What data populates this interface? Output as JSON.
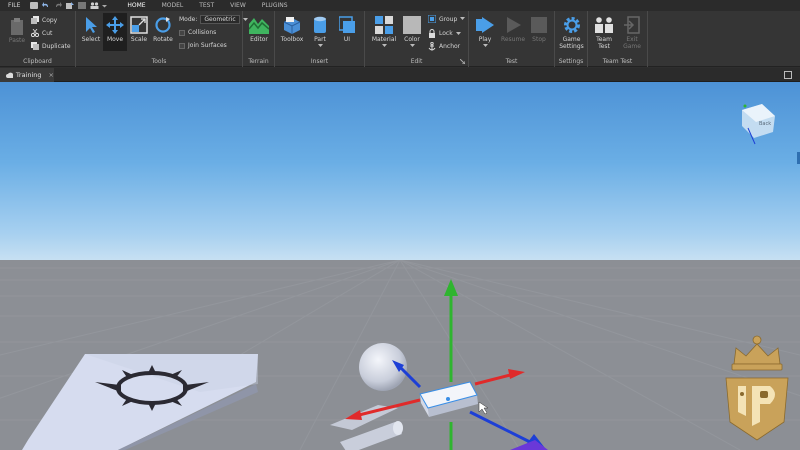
{
  "menu": {
    "file": "FILE",
    "tabs": [
      {
        "label": "HOME",
        "active": true
      },
      {
        "label": "MODEL",
        "active": false
      },
      {
        "label": "TEST",
        "active": false
      },
      {
        "label": "VIEW",
        "active": false
      },
      {
        "label": "PLUGINS",
        "active": false
      }
    ]
  },
  "ribbon": {
    "clipboard": {
      "paste": "Paste",
      "copy": "Copy",
      "cut": "Cut",
      "duplicate": "Duplicate",
      "label": "Clipboard"
    },
    "tools": {
      "select": "Select",
      "move": "Move",
      "scale": "Scale",
      "rotate": "Rotate",
      "mode_label": "Mode:",
      "mode_value": "Geometric",
      "collisions": "Collisions",
      "join_surfaces": "Join Surfaces",
      "label": "Tools"
    },
    "terrain": {
      "editor": "Editor",
      "label": "Terrain"
    },
    "insert": {
      "toolbox": "Toolbox",
      "part": "Part",
      "ui": "UI",
      "label": "Insert"
    },
    "edit": {
      "material": "Material",
      "color": "Color",
      "group": "Group",
      "lock": "Lock",
      "anchor": "Anchor",
      "label": "Edit"
    },
    "test": {
      "play": "Play",
      "resume": "Resume",
      "stop": "Stop",
      "label": "Test"
    },
    "settings": {
      "game_settings_line1": "Game",
      "game_settings_line2": "Settings",
      "label": "Settings"
    },
    "team_test": {
      "team_test_line1": "Team",
      "team_test_line2": "Test",
      "exit_game_line1": "Exit",
      "exit_game_line2": "Game",
      "label": "Team Test"
    }
  },
  "document": {
    "tab_label": "Training",
    "close": "×"
  },
  "viewcube": {
    "face_label": "Back"
  },
  "colors": {
    "accent": "#3a8ee6",
    "axis_x": "#e02a2a",
    "axis_y": "#2fb52f",
    "axis_z": "#1d3fd6",
    "sky_top": "#4d92d6",
    "ground": "#8c8f95",
    "ribbon_bg": "#353535",
    "logo_gold": "#c9a25a"
  },
  "icons": [
    "paste-icon",
    "copy-icon",
    "cut-icon",
    "duplicate-icon",
    "select-icon",
    "move-icon",
    "scale-icon",
    "rotate-icon",
    "terrain-editor-icon",
    "toolbox-icon",
    "part-icon",
    "ui-icon",
    "material-icon",
    "color-icon",
    "group-icon",
    "lock-icon",
    "anchor-icon",
    "play-icon",
    "resume-icon",
    "stop-icon",
    "game-settings-icon",
    "team-test-icon",
    "exit-game-icon"
  ]
}
